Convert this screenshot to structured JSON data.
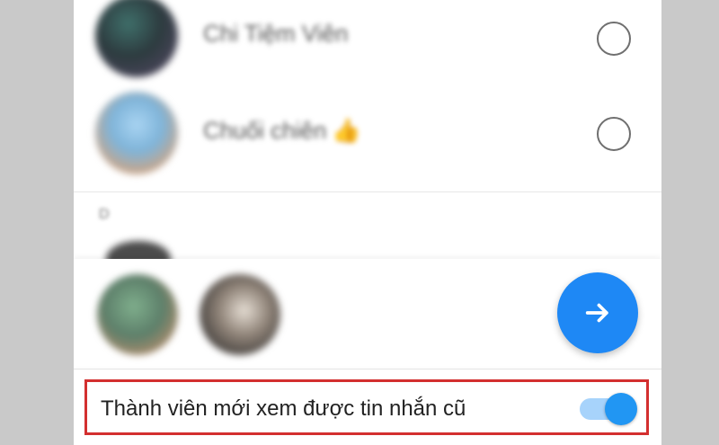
{
  "contacts": [
    {
      "name": "Chi Tiệm Viên",
      "selected": false
    },
    {
      "name": "Chuối chiên",
      "emoji": "👍",
      "selected": false
    }
  ],
  "section_letter": "D",
  "selected_members_count": 2,
  "fab": {
    "icon": "arrow-right-icon"
  },
  "setting": {
    "label": "Thành viên mới xem được tin nhắn cũ",
    "enabled": true
  },
  "colors": {
    "accent": "#2196f3",
    "fab": "#1e88f5",
    "highlight_border": "#d32f2f"
  }
}
